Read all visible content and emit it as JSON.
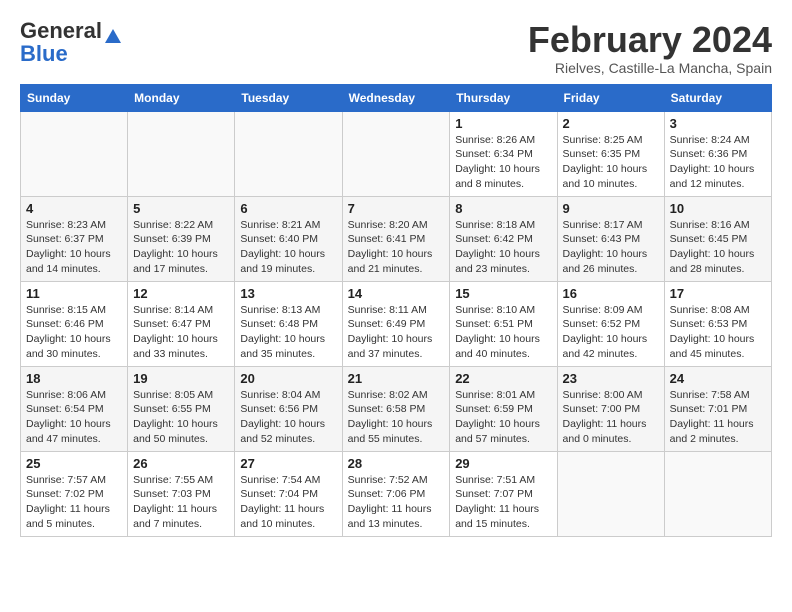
{
  "header": {
    "logo_general": "General",
    "logo_blue": "Blue",
    "month_title": "February 2024",
    "subtitle": "Rielves, Castille-La Mancha, Spain"
  },
  "days_of_week": [
    "Sunday",
    "Monday",
    "Tuesday",
    "Wednesday",
    "Thursday",
    "Friday",
    "Saturday"
  ],
  "weeks": [
    [
      {
        "day": "",
        "info": ""
      },
      {
        "day": "",
        "info": ""
      },
      {
        "day": "",
        "info": ""
      },
      {
        "day": "",
        "info": ""
      },
      {
        "day": "1",
        "info": "Sunrise: 8:26 AM\nSunset: 6:34 PM\nDaylight: 10 hours\nand 8 minutes."
      },
      {
        "day": "2",
        "info": "Sunrise: 8:25 AM\nSunset: 6:35 PM\nDaylight: 10 hours\nand 10 minutes."
      },
      {
        "day": "3",
        "info": "Sunrise: 8:24 AM\nSunset: 6:36 PM\nDaylight: 10 hours\nand 12 minutes."
      }
    ],
    [
      {
        "day": "4",
        "info": "Sunrise: 8:23 AM\nSunset: 6:37 PM\nDaylight: 10 hours\nand 14 minutes."
      },
      {
        "day": "5",
        "info": "Sunrise: 8:22 AM\nSunset: 6:39 PM\nDaylight: 10 hours\nand 17 minutes."
      },
      {
        "day": "6",
        "info": "Sunrise: 8:21 AM\nSunset: 6:40 PM\nDaylight: 10 hours\nand 19 minutes."
      },
      {
        "day": "7",
        "info": "Sunrise: 8:20 AM\nSunset: 6:41 PM\nDaylight: 10 hours\nand 21 minutes."
      },
      {
        "day": "8",
        "info": "Sunrise: 8:18 AM\nSunset: 6:42 PM\nDaylight: 10 hours\nand 23 minutes."
      },
      {
        "day": "9",
        "info": "Sunrise: 8:17 AM\nSunset: 6:43 PM\nDaylight: 10 hours\nand 26 minutes."
      },
      {
        "day": "10",
        "info": "Sunrise: 8:16 AM\nSunset: 6:45 PM\nDaylight: 10 hours\nand 28 minutes."
      }
    ],
    [
      {
        "day": "11",
        "info": "Sunrise: 8:15 AM\nSunset: 6:46 PM\nDaylight: 10 hours\nand 30 minutes."
      },
      {
        "day": "12",
        "info": "Sunrise: 8:14 AM\nSunset: 6:47 PM\nDaylight: 10 hours\nand 33 minutes."
      },
      {
        "day": "13",
        "info": "Sunrise: 8:13 AM\nSunset: 6:48 PM\nDaylight: 10 hours\nand 35 minutes."
      },
      {
        "day": "14",
        "info": "Sunrise: 8:11 AM\nSunset: 6:49 PM\nDaylight: 10 hours\nand 37 minutes."
      },
      {
        "day": "15",
        "info": "Sunrise: 8:10 AM\nSunset: 6:51 PM\nDaylight: 10 hours\nand 40 minutes."
      },
      {
        "day": "16",
        "info": "Sunrise: 8:09 AM\nSunset: 6:52 PM\nDaylight: 10 hours\nand 42 minutes."
      },
      {
        "day": "17",
        "info": "Sunrise: 8:08 AM\nSunset: 6:53 PM\nDaylight: 10 hours\nand 45 minutes."
      }
    ],
    [
      {
        "day": "18",
        "info": "Sunrise: 8:06 AM\nSunset: 6:54 PM\nDaylight: 10 hours\nand 47 minutes."
      },
      {
        "day": "19",
        "info": "Sunrise: 8:05 AM\nSunset: 6:55 PM\nDaylight: 10 hours\nand 50 minutes."
      },
      {
        "day": "20",
        "info": "Sunrise: 8:04 AM\nSunset: 6:56 PM\nDaylight: 10 hours\nand 52 minutes."
      },
      {
        "day": "21",
        "info": "Sunrise: 8:02 AM\nSunset: 6:58 PM\nDaylight: 10 hours\nand 55 minutes."
      },
      {
        "day": "22",
        "info": "Sunrise: 8:01 AM\nSunset: 6:59 PM\nDaylight: 10 hours\nand 57 minutes."
      },
      {
        "day": "23",
        "info": "Sunrise: 8:00 AM\nSunset: 7:00 PM\nDaylight: 11 hours\nand 0 minutes."
      },
      {
        "day": "24",
        "info": "Sunrise: 7:58 AM\nSunset: 7:01 PM\nDaylight: 11 hours\nand 2 minutes."
      }
    ],
    [
      {
        "day": "25",
        "info": "Sunrise: 7:57 AM\nSunset: 7:02 PM\nDaylight: 11 hours\nand 5 minutes."
      },
      {
        "day": "26",
        "info": "Sunrise: 7:55 AM\nSunset: 7:03 PM\nDaylight: 11 hours\nand 7 minutes."
      },
      {
        "day": "27",
        "info": "Sunrise: 7:54 AM\nSunset: 7:04 PM\nDaylight: 11 hours\nand 10 minutes."
      },
      {
        "day": "28",
        "info": "Sunrise: 7:52 AM\nSunset: 7:06 PM\nDaylight: 11 hours\nand 13 minutes."
      },
      {
        "day": "29",
        "info": "Sunrise: 7:51 AM\nSunset: 7:07 PM\nDaylight: 11 hours\nand 15 minutes."
      },
      {
        "day": "",
        "info": ""
      },
      {
        "day": "",
        "info": ""
      }
    ]
  ]
}
